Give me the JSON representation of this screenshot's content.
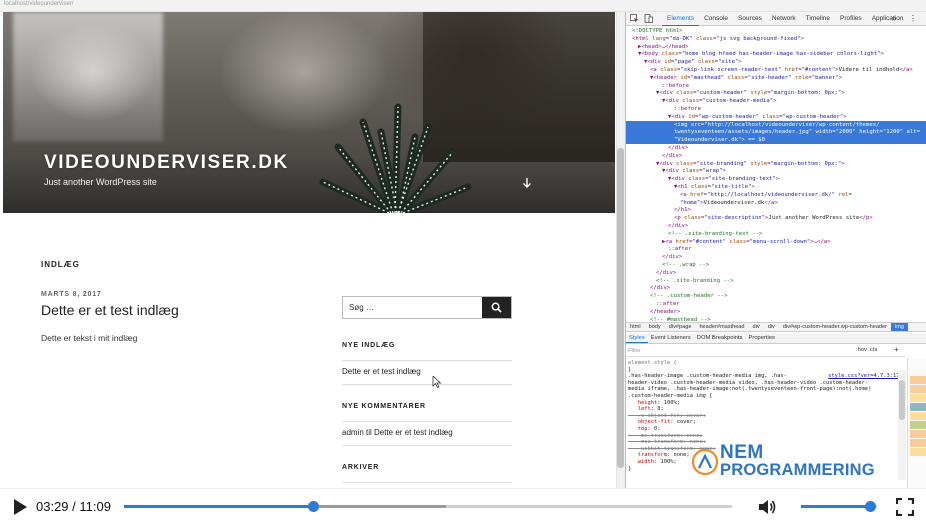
{
  "browser": {
    "url": "localhost/videounderviser/"
  },
  "site": {
    "title": "VIDEOUNDERVISER.DK",
    "description": "Just another WordPress site",
    "posts_heading": "INDLÆG",
    "post": {
      "date": "MARTS 8, 2017",
      "title": "Dette er et test indlæg",
      "excerpt": "Dette er tekst i mit indlæg"
    },
    "search": {
      "placeholder": "Søg …"
    },
    "widgets": {
      "recent_posts": {
        "heading": "NYE INDLÆG",
        "item": "Dette er et test indlæg"
      },
      "recent_comments": {
        "heading": "NYE KOMMENTARER",
        "item": "admin til Dette er et test indlæg"
      },
      "archives": {
        "heading": "ARKIVER"
      }
    }
  },
  "devtools": {
    "tabs": [
      "Elements",
      "Console",
      "Sources",
      "Network",
      "Timeline",
      "Profiles",
      "Application"
    ],
    "active_tab": "Elements",
    "more": "»",
    "menu": "⋮",
    "dom": [
      {
        "indent": 1,
        "parts": [
          [
            "com",
            "<!DOCTYPE html>"
          ]
        ]
      },
      {
        "indent": 1,
        "parts": [
          [
            "tag",
            "<html "
          ],
          [
            "attr",
            "lang"
          ],
          [
            "tag",
            "="
          ],
          [
            "val",
            "\"da-DK\""
          ],
          [
            "tag",
            " "
          ],
          [
            "attr",
            "class"
          ],
          [
            "tag",
            "="
          ],
          [
            "val",
            "\"js svg background-fixed\""
          ],
          [
            "tag",
            ">"
          ]
        ]
      },
      {
        "indent": 2,
        "parts": [
          [
            "tag",
            "▶<head>…</head>"
          ]
        ]
      },
      {
        "indent": 2,
        "parts": [
          [
            "tag",
            "▼<body "
          ],
          [
            "attr",
            "class"
          ],
          [
            "tag",
            "="
          ],
          [
            "val",
            "\"home blog hfeed has-header-image has-sidebar colors-light\""
          ],
          [
            "tag",
            ">"
          ]
        ]
      },
      {
        "indent": 3,
        "parts": [
          [
            "tag",
            "▼<div "
          ],
          [
            "attr",
            "id"
          ],
          [
            "tag",
            "="
          ],
          [
            "val",
            "\"page\""
          ],
          [
            "tag",
            " "
          ],
          [
            "attr",
            "class"
          ],
          [
            "tag",
            "="
          ],
          [
            "val",
            "\"site\""
          ],
          [
            "tag",
            ">"
          ]
        ]
      },
      {
        "indent": 4,
        "parts": [
          [
            "tag",
            "<a "
          ],
          [
            "attr",
            "class"
          ],
          [
            "tag",
            "="
          ],
          [
            "val",
            "\"skip-link screen-reader-text\""
          ],
          [
            "tag",
            " "
          ],
          [
            "attr",
            "href"
          ],
          [
            "tag",
            "="
          ],
          [
            "val",
            "\"#content\""
          ],
          [
            "tag",
            ">"
          ],
          [
            "txt",
            "Videre til indhold"
          ],
          [
            "tag",
            "</a>"
          ]
        ]
      },
      {
        "indent": 4,
        "parts": [
          [
            "tag",
            "▼<header "
          ],
          [
            "attr",
            "id"
          ],
          [
            "tag",
            "="
          ],
          [
            "val",
            "\"masthead\""
          ],
          [
            "tag",
            " "
          ],
          [
            "attr",
            "class"
          ],
          [
            "tag",
            "="
          ],
          [
            "val",
            "\"site-header\""
          ],
          [
            "tag",
            " "
          ],
          [
            "attr",
            "role"
          ],
          [
            "tag",
            "="
          ],
          [
            "val",
            "\"banner\""
          ],
          [
            "tag",
            ">"
          ]
        ]
      },
      {
        "indent": 6,
        "parts": [
          [
            "tag",
            "::before"
          ]
        ]
      },
      {
        "indent": 5,
        "parts": [
          [
            "tag",
            "▼<div "
          ],
          [
            "attr",
            "class"
          ],
          [
            "tag",
            "="
          ],
          [
            "val",
            "\"custom-header\""
          ],
          [
            "tag",
            " "
          ],
          [
            "attr",
            "style"
          ],
          [
            "tag",
            "="
          ],
          [
            "val",
            "\"margin-bottom: 0px;\""
          ],
          [
            "tag",
            ">"
          ]
        ]
      },
      {
        "indent": 6,
        "parts": [
          [
            "tag",
            "▼<div "
          ],
          [
            "attr",
            "class"
          ],
          [
            "tag",
            "="
          ],
          [
            "val",
            "\"custom-header-media\""
          ],
          [
            "tag",
            ">"
          ]
        ]
      },
      {
        "indent": 8,
        "parts": [
          [
            "tag",
            "::before"
          ]
        ]
      },
      {
        "indent": 7,
        "parts": [
          [
            "tag",
            "▼<div "
          ],
          [
            "attr",
            "id"
          ],
          [
            "tag",
            "="
          ],
          [
            "val",
            "\"wp-custom-header\""
          ],
          [
            "tag",
            " "
          ],
          [
            "attr",
            "class"
          ],
          [
            "tag",
            "="
          ],
          [
            "val",
            "\"wp-custom-header\""
          ],
          [
            "tag",
            ">"
          ]
        ]
      },
      {
        "indent": 8,
        "sel": true,
        "parts": [
          [
            "tag",
            "<img "
          ],
          [
            "attr",
            "src"
          ],
          [
            "tag",
            "="
          ],
          [
            "val",
            "\"http://localhost/videounderviser/wp-content/themes/"
          ]
        ]
      },
      {
        "indent": 8,
        "sel": true,
        "parts": [
          [
            "val",
            "twentyseventeen/assets/images/header.jpg\""
          ],
          [
            "tag",
            " "
          ],
          [
            "attr",
            "width"
          ],
          [
            "tag",
            "="
          ],
          [
            "val",
            "\"2000\""
          ],
          [
            "tag",
            " "
          ],
          [
            "attr",
            "height"
          ],
          [
            "tag",
            "="
          ],
          [
            "val",
            "\"1200\""
          ],
          [
            "tag",
            " "
          ],
          [
            "attr",
            "alt"
          ],
          [
            "tag",
            "="
          ]
        ]
      },
      {
        "indent": 8,
        "sel": true,
        "parts": [
          [
            "val",
            "\"Videounderviser.dk\""
          ],
          [
            "tag",
            "> == $0"
          ]
        ]
      },
      {
        "indent": 7,
        "parts": [
          [
            "tag",
            "</div>"
          ]
        ]
      },
      {
        "indent": 6,
        "parts": [
          [
            "tag",
            "</div>"
          ]
        ]
      },
      {
        "indent": 5,
        "parts": [
          [
            "tag",
            "▼<div "
          ],
          [
            "attr",
            "class"
          ],
          [
            "tag",
            "="
          ],
          [
            "val",
            "\"site-branding\""
          ],
          [
            "tag",
            " "
          ],
          [
            "attr",
            "style"
          ],
          [
            "tag",
            "="
          ],
          [
            "val",
            "\"margin-bottom: 0px;\""
          ],
          [
            "tag",
            ">"
          ]
        ]
      },
      {
        "indent": 6,
        "parts": [
          [
            "tag",
            "▼<div "
          ],
          [
            "attr",
            "class"
          ],
          [
            "tag",
            "="
          ],
          [
            "val",
            "\"wrap\""
          ],
          [
            "tag",
            ">"
          ]
        ]
      },
      {
        "indent": 7,
        "parts": [
          [
            "tag",
            "▼<div "
          ],
          [
            "attr",
            "class"
          ],
          [
            "tag",
            "="
          ],
          [
            "val",
            "\"site-branding-text\""
          ],
          [
            "tag",
            ">"
          ]
        ]
      },
      {
        "indent": 8,
        "parts": [
          [
            "tag",
            "▼<h1 "
          ],
          [
            "attr",
            "class"
          ],
          [
            "tag",
            "="
          ],
          [
            "val",
            "\"site-title\""
          ],
          [
            "tag",
            ">"
          ]
        ]
      },
      {
        "indent": 9,
        "parts": [
          [
            "tag",
            "<a "
          ],
          [
            "attr",
            "href"
          ],
          [
            "tag",
            "="
          ],
          [
            "val",
            "\"http://localhost/videounderviser.dk/\""
          ],
          [
            "tag",
            " "
          ],
          [
            "attr",
            "rel"
          ],
          [
            "tag",
            "="
          ]
        ]
      },
      {
        "indent": 9,
        "parts": [
          [
            "val",
            "\"home\""
          ],
          [
            "tag",
            ">"
          ],
          [
            "txt",
            "Videounderviser.dk"
          ],
          [
            "tag",
            "</a>"
          ]
        ]
      },
      {
        "indent": 8,
        "parts": [
          [
            "tag",
            "</h1>"
          ]
        ]
      },
      {
        "indent": 8,
        "parts": [
          [
            "tag",
            "<p "
          ],
          [
            "attr",
            "class"
          ],
          [
            "tag",
            "="
          ],
          [
            "val",
            "\"site-description\""
          ],
          [
            "tag",
            ">"
          ],
          [
            "txt",
            "Just another WordPress site"
          ],
          [
            "tag",
            "</p>"
          ]
        ]
      },
      {
        "indent": 7,
        "parts": [
          [
            "tag",
            "</div>"
          ]
        ]
      },
      {
        "indent": 7,
        "parts": [
          [
            "com",
            "<!-- .site-branding-text -->"
          ]
        ]
      },
      {
        "indent": 6,
        "parts": [
          [
            "tag",
            "▶<a "
          ],
          [
            "attr",
            "href"
          ],
          [
            "tag",
            "="
          ],
          [
            "val",
            "\"#content\""
          ],
          [
            "tag",
            " "
          ],
          [
            "attr",
            "class"
          ],
          [
            "tag",
            "="
          ],
          [
            "val",
            "\"menu-scroll-down\""
          ],
          [
            "tag",
            ">…</a>"
          ]
        ]
      },
      {
        "indent": 7,
        "parts": [
          [
            "tag",
            "::after"
          ]
        ]
      },
      {
        "indent": 6,
        "parts": [
          [
            "tag",
            "</div>"
          ]
        ]
      },
      {
        "indent": 6,
        "parts": [
          [
            "com",
            "<!-- .wrap -->"
          ]
        ]
      },
      {
        "indent": 5,
        "parts": [
          [
            "tag",
            "</div>"
          ]
        ]
      },
      {
        "indent": 5,
        "parts": [
          [
            "com",
            "<!-- .site-branding -->"
          ]
        ]
      },
      {
        "indent": 4,
        "parts": [
          [
            "tag",
            "</div>"
          ]
        ]
      },
      {
        "indent": 4,
        "parts": [
          [
            "com",
            "<!-- .custom-header -->"
          ]
        ]
      },
      {
        "indent": 5,
        "parts": [
          [
            "tag",
            "::after"
          ]
        ]
      },
      {
        "indent": 4,
        "parts": [
          [
            "tag",
            "</header>"
          ]
        ]
      },
      {
        "indent": 4,
        "parts": [
          [
            "com",
            "<!-- #masthead -->"
          ]
        ]
      }
    ],
    "breadcrumbs": [
      "html",
      "body",
      "div#page",
      "header#masthead",
      "div",
      "div",
      "div#wp-custom-header.wp-custom-header",
      "img"
    ],
    "styles_tabs": [
      "Styles",
      "Event Listeners",
      "DOM Breakpoints",
      "Properties"
    ],
    "filter_placeholder": "Filter",
    "hov_cls": ":hov  .cls",
    "add_rule": "+",
    "styles": [
      {
        "parts": [
          [
            "sel",
            "element.style {"
          ]
        ]
      },
      {
        "parts": [
          [
            "txt",
            "}"
          ]
        ]
      },
      {
        "parts": [
          [
            "txt",
            ".has-header-image .custom-header-media img, .has-"
          ]
        ],
        "src": "style.css?ver=4.7.3:1731"
      },
      {
        "parts": [
          [
            "txt",
            "header-video .custom-header-media video, .has-header-video .custom-header-"
          ]
        ]
      },
      {
        "parts": [
          [
            "txt",
            "media iframe, .has-header-image:not(.twentyseventeen-front-page):not(.home)"
          ]
        ]
      },
      {
        "parts": [
          [
            "txt",
            ".custom-header-media img {"
          ]
        ]
      },
      {
        "parts": [
          [
            "prop",
            "   height"
          ],
          [
            "txt",
            ": 100%;"
          ]
        ]
      },
      {
        "parts": [
          [
            "prop",
            "   left"
          ],
          [
            "txt",
            ": 0;"
          ]
        ]
      },
      {
        "parts": [
          [
            "strike",
            "   -o-object-fit: cover;"
          ]
        ]
      },
      {
        "parts": [
          [
            "prop",
            "   object-fit"
          ],
          [
            "txt",
            ": cover;"
          ]
        ]
      },
      {
        "parts": [
          [
            "prop",
            "   top"
          ],
          [
            "txt",
            ": 0;"
          ]
        ]
      },
      {
        "parts": [
          [
            "strike",
            "   -ms-transform: none;"
          ]
        ]
      },
      {
        "parts": [
          [
            "strike",
            "   -moz-transform: none;"
          ]
        ]
      },
      {
        "parts": [
          [
            "strike",
            "   -webkit-transform: none;"
          ]
        ]
      },
      {
        "parts": [
          [
            "prop",
            "   transform"
          ],
          [
            "txt",
            ": none;"
          ]
        ]
      },
      {
        "parts": [
          [
            "prop",
            "   width"
          ],
          [
            "txt",
            ": 100%;"
          ]
        ]
      },
      {
        "parts": [
          [
            "txt",
            "}"
          ]
        ]
      }
    ]
  },
  "watermark": {
    "line1": "NEM",
    "line2": "PROGRAMMERING"
  },
  "player": {
    "time": "03:29 / 11:09",
    "progress_fraction": 0.3124,
    "buffered_fraction": 0.53,
    "volume_fraction": 0.92
  },
  "colors": {
    "accent": "#2e7bd6",
    "devtools_selection": "#3879d9",
    "watermark": "#2f74c0"
  }
}
